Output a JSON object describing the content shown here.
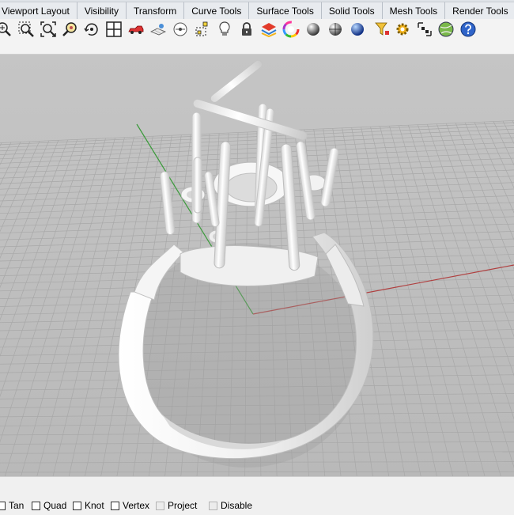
{
  "tabs": [
    {
      "label": "Viewport Layout"
    },
    {
      "label": "Visibility"
    },
    {
      "label": "Transform"
    },
    {
      "label": "Curve Tools"
    },
    {
      "label": "Surface Tools"
    },
    {
      "label": "Solid Tools"
    },
    {
      "label": "Mesh Tools"
    },
    {
      "label": "Render Tools"
    }
  ],
  "toolbar": {
    "icons": [
      "zoom-extents-icon",
      "zoom-window-icon",
      "zoom-selected-icon",
      "zoom-target-icon",
      "rotate-view-icon",
      "four-viewports-icon",
      "car-icon",
      "named-views-icon",
      "object-snap-icon",
      "select-points-icon",
      "light-bulb-icon",
      "lock-icon",
      "layer-icon",
      "color-wheel-icon",
      "shaded-sphere-icon",
      "rendered-sphere-icon",
      "blue-sphere-icon",
      "filter-icon",
      "gear-icon",
      "group-icon",
      "globe-icon",
      "help-icon"
    ]
  },
  "status": {
    "snaps": [
      {
        "label": "Tan",
        "checked": false,
        "enabled": true
      },
      {
        "label": "Quad",
        "checked": false,
        "enabled": true
      },
      {
        "label": "Knot",
        "checked": false,
        "enabled": true
      },
      {
        "label": "Vertex",
        "checked": false,
        "enabled": true
      },
      {
        "label": "Project",
        "checked": false,
        "enabled": false
      },
      {
        "label": "Disable",
        "checked": false,
        "enabled": false
      }
    ]
  },
  "colors": {
    "viewport_bg": "#c2c2c2",
    "grid_line": "#a8a8a8",
    "axis_x": "#b04040",
    "axis_y": "#3a9a3a",
    "model": "#f2f2f2"
  }
}
